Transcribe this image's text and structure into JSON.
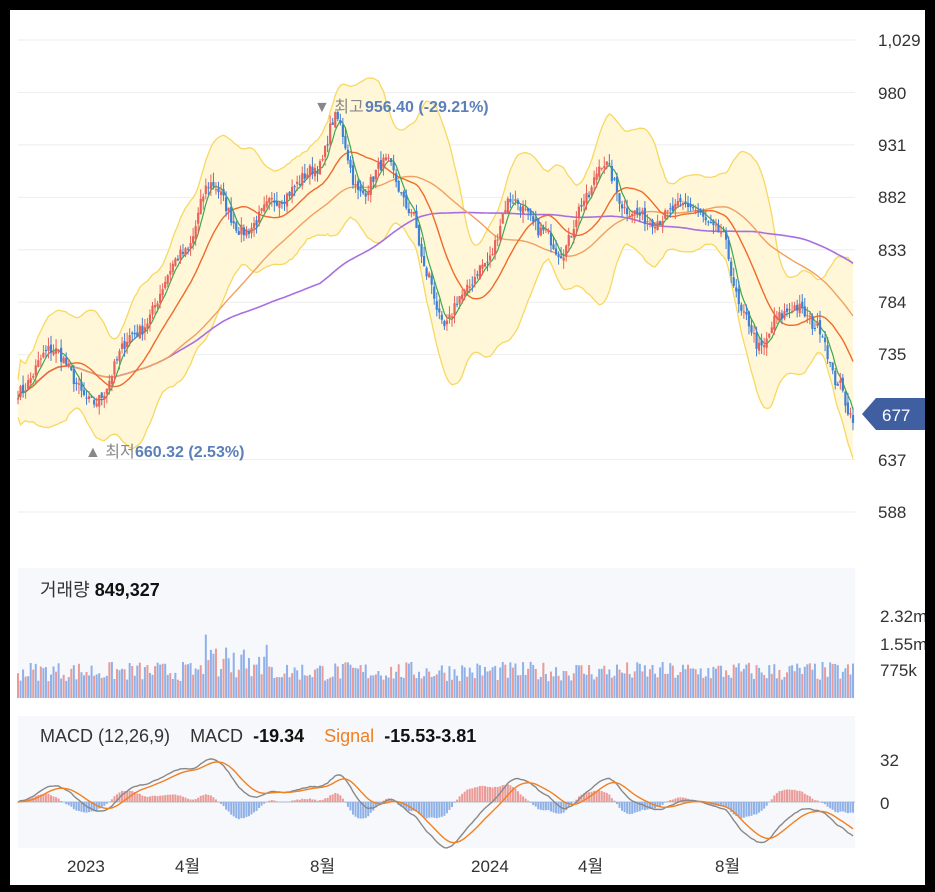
{
  "colors": {
    "up": "#e8625b",
    "down": "#3f7fd6",
    "ma_short": "#3aa84f",
    "ma_mid": "#f06a2a",
    "ma_long": "#f0a060",
    "ma_200": "#a86fe0",
    "bollinger_line": "#f7d860",
    "bollinger_fill": "#fff7d8",
    "price_tag": "#3f5fa0",
    "macd_line": "#888888",
    "signal_line": "#f08020",
    "vol_up": "#ea9a97",
    "vol_down": "#8fb1e8"
  },
  "price_panel": {
    "y_axis_labels": [
      "1,029",
      "980",
      "931",
      "882",
      "833",
      "784",
      "735",
      "637",
      "588"
    ],
    "current_price": "677",
    "high_marker": "▼ 최고",
    "high_value": "956.40 (-29.21%)",
    "low_marker": "▲ 최저",
    "low_value": "660.32 (2.53%)"
  },
  "volume_panel": {
    "label": "거래량",
    "value": "849,327",
    "y_axis_labels": [
      "2.32m",
      "1.55m",
      "775k"
    ]
  },
  "macd_panel": {
    "label": "MACD (12,26,9)",
    "macd_label": "MACD",
    "macd_value": "-19.34",
    "signal_label": "Signal",
    "signal_value": "-15.53",
    "hist_value": "-3.81",
    "y_axis_labels": [
      "32",
      "0"
    ]
  },
  "x_axis_labels": [
    "2023",
    "4월",
    "8월",
    "2024",
    "4월",
    "8월"
  ],
  "chart_data": {
    "type": "candlestick",
    "x_ticks": [
      "2023",
      "4월",
      "8월",
      "2024",
      "4월",
      "8월"
    ],
    "price_axis": [
      588,
      637,
      735,
      784,
      833,
      882,
      931,
      980,
      1029
    ],
    "key_points": [
      {
        "t": 0,
        "p": 700
      },
      {
        "t": 0.04,
        "p": 740
      },
      {
        "t": 0.09,
        "p": 690
      },
      {
        "t": 0.14,
        "p": 755
      },
      {
        "t": 0.2,
        "p": 830
      },
      {
        "t": 0.23,
        "p": 895
      },
      {
        "t": 0.27,
        "p": 850
      },
      {
        "t": 0.31,
        "p": 880
      },
      {
        "t": 0.36,
        "p": 910
      },
      {
        "t": 0.38,
        "p": 956
      },
      {
        "t": 0.41,
        "p": 885
      },
      {
        "t": 0.44,
        "p": 915
      },
      {
        "t": 0.47,
        "p": 870
      },
      {
        "t": 0.49,
        "p": 810
      },
      {
        "t": 0.51,
        "p": 760
      },
      {
        "t": 0.53,
        "p": 790
      },
      {
        "t": 0.56,
        "p": 820
      },
      {
        "t": 0.59,
        "p": 880
      },
      {
        "t": 0.63,
        "p": 850
      },
      {
        "t": 0.65,
        "p": 830
      },
      {
        "t": 0.68,
        "p": 880
      },
      {
        "t": 0.7,
        "p": 915
      },
      {
        "t": 0.73,
        "p": 870
      },
      {
        "t": 0.76,
        "p": 860
      },
      {
        "t": 0.8,
        "p": 875
      },
      {
        "t": 0.84,
        "p": 850
      },
      {
        "t": 0.87,
        "p": 770
      },
      {
        "t": 0.89,
        "p": 740
      },
      {
        "t": 0.91,
        "p": 770
      },
      {
        "t": 0.93,
        "p": 780
      },
      {
        "t": 0.96,
        "p": 760
      },
      {
        "t": 0.98,
        "p": 710
      },
      {
        "t": 1.0,
        "p": 677
      }
    ],
    "high": {
      "label": "최고",
      "value": 956.4,
      "change_pct": -29.21
    },
    "low": {
      "label": "최저",
      "value": 660.32,
      "change_pct": 2.53
    },
    "last_price": 677,
    "volume_last": 849327,
    "volume_axis": [
      "775k",
      "1.55m",
      "2.32m"
    ],
    "macd": {
      "fast": 12,
      "slow": 26,
      "signal": 9,
      "macd": -19.34,
      "signal_value": -15.53,
      "histogram": -3.81,
      "axis": [
        0,
        32
      ]
    }
  }
}
